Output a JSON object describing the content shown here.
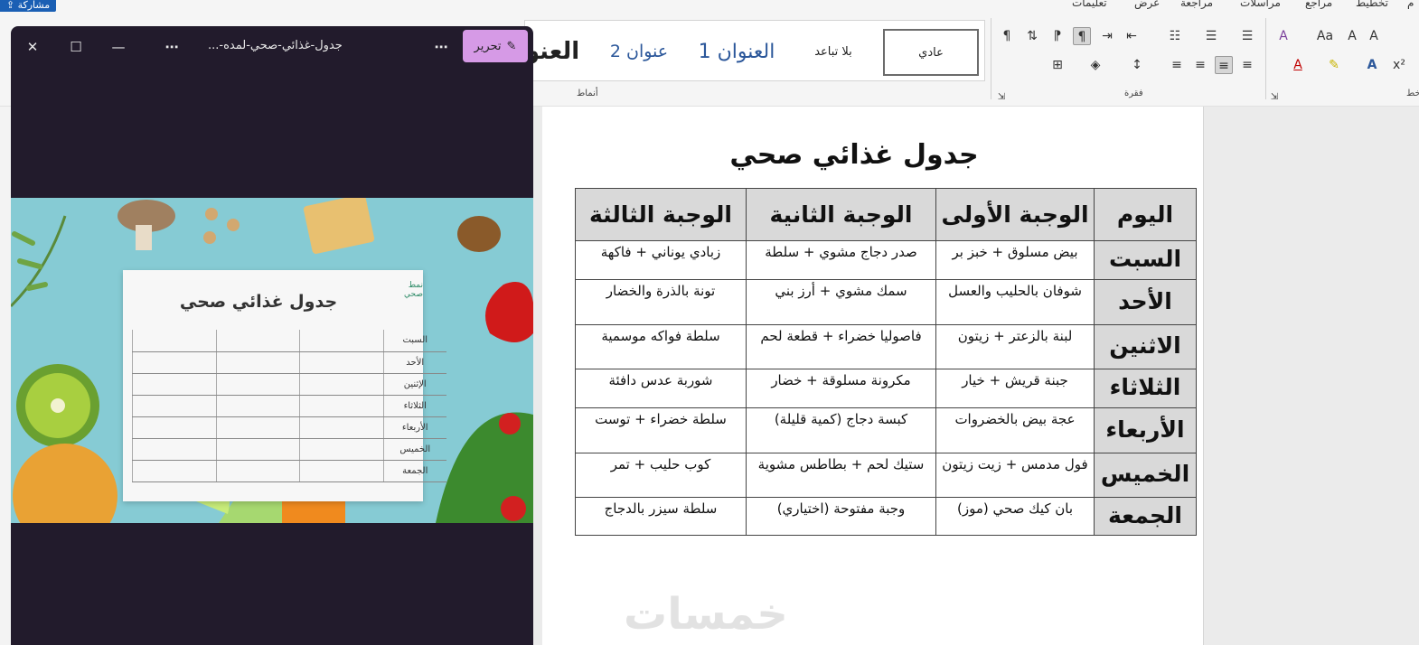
{
  "ribbon": {
    "share_label": "مشاركة",
    "tabs": [
      "تعليمات",
      "عرض",
      "مراجعة",
      "مراسلات",
      "مراجع",
      "تخطيط",
      "م"
    ],
    "styles": {
      "normal": "عادي",
      "no_spacing": "بلا تباعد",
      "heading1": "العنوان 1",
      "heading2": "عنوان 2",
      "title_partial": "العنو"
    },
    "group_labels": {
      "styles": "أنماط",
      "paragraph": "فقرة",
      "font": "خط"
    }
  },
  "viewer": {
    "title": "جدول-غذائي-صحي-لمده-...",
    "edit_label": "تحرير",
    "card_title": "جدول غذائي صحي",
    "card_brand": "نمط صحي",
    "card_days": [
      "السبت",
      "الأحد",
      "الإثنين",
      "الثلاثاء",
      "الأربعاء",
      "الخميس",
      "الجمعة"
    ]
  },
  "document": {
    "title": "جدول غذائي صحي",
    "headers": [
      "اليوم",
      "الوجبة الأولى",
      "الوجبة الثانية",
      "الوجبة الثالثة"
    ],
    "rows": [
      [
        "السبت",
        "بيض مسلوق + خبز بر",
        "صدر دجاج مشوي + سلطة",
        "زبادي يوناني + فاكهة"
      ],
      [
        "الأحد",
        "شوفان بالحليب والعسل",
        "سمك مشوي + أرز بني",
        "تونة بالذرة والخضار"
      ],
      [
        "الاثنين",
        "لبنة بالزعتر + زيتون",
        "فاصوليا خضراء + قطعة لحم",
        "سلطة فواكه موسمية"
      ],
      [
        "الثلاثاء",
        "جبنة قريش + خيار",
        "مكرونة مسلوقة + خضار",
        "شوربة عدس دافئة"
      ],
      [
        "الأربعاء",
        "عجة بيض بالخضروات",
        "كبسة دجاج (كمية قليلة)",
        "سلطة خضراء + توست"
      ],
      [
        "الخميس",
        "فول مدمس + زيت زيتون",
        "ستيك لحم + بطاطس مشوية",
        "كوب حليب + تمر"
      ],
      [
        "الجمعة",
        "بان كيك صحي (موز)",
        "وجبة مفتوحة (اختياري)",
        "سلطة سيزر بالدجاج"
      ]
    ],
    "watermark": "خمسات"
  }
}
